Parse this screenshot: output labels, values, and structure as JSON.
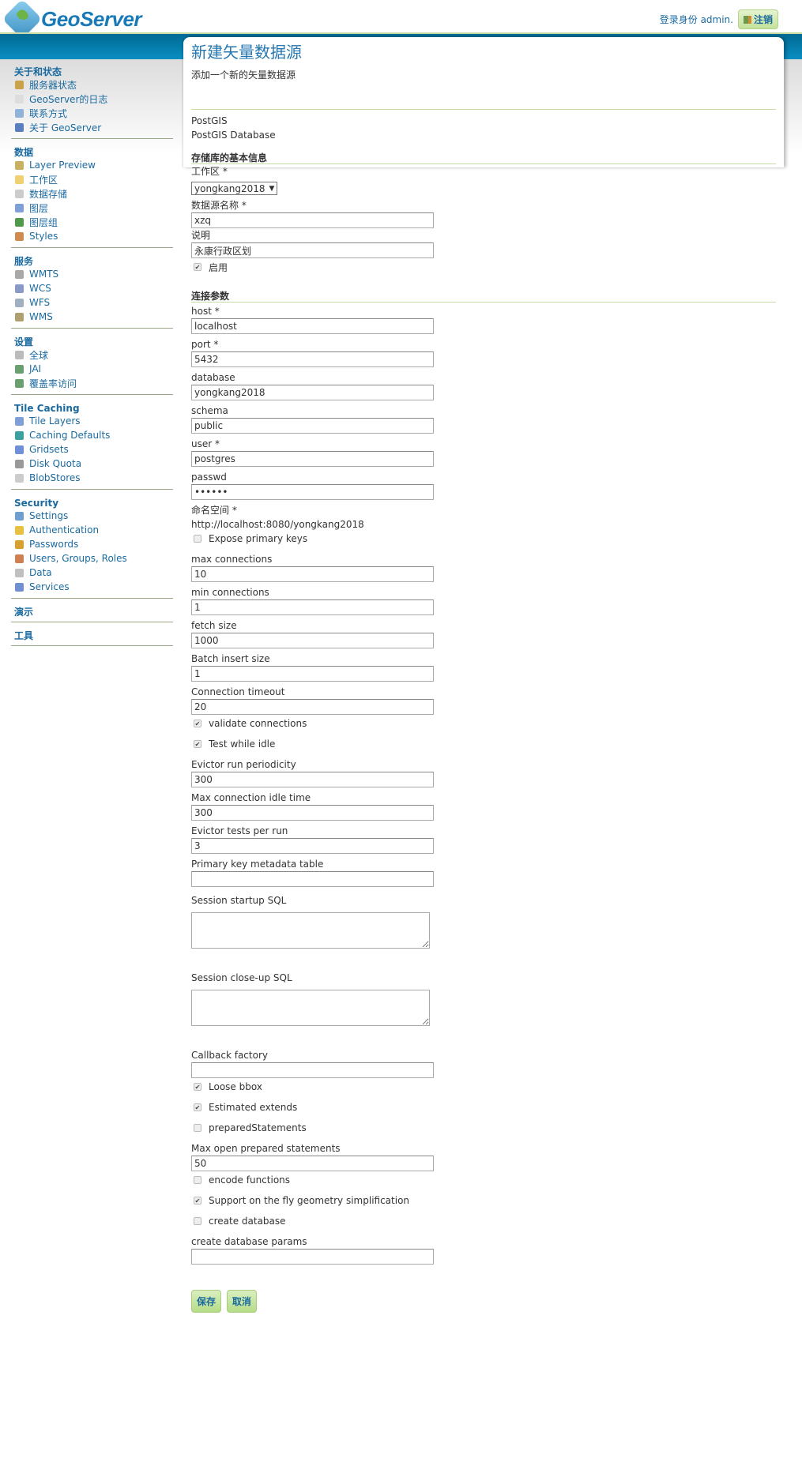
{
  "header": {
    "app_name": "GeoServer",
    "login_text": "登录身份 admin.",
    "logout_label": "注销"
  },
  "colors": {
    "brand_blue": "#1a7ab7",
    "band_blue": "#0a8ec2",
    "accent_green": "#c9dca6",
    "link": "#1a6aa0"
  },
  "sidebar": {
    "sections": [
      {
        "title": "关于和状态",
        "items": [
          {
            "label": "服务器状态",
            "icon": "server-status-icon"
          },
          {
            "label": "GeoServer的日志",
            "icon": "log-icon"
          },
          {
            "label": "联系方式",
            "icon": "contact-icon"
          },
          {
            "label": "关于 GeoServer",
            "icon": "about-icon"
          }
        ]
      },
      {
        "title": "数据",
        "items": [
          {
            "label": "Layer Preview",
            "icon": "layer-preview-icon"
          },
          {
            "label": "工作区",
            "icon": "folder-icon"
          },
          {
            "label": "数据存储",
            "icon": "datastore-icon"
          },
          {
            "label": "图层",
            "icon": "layer-icon"
          },
          {
            "label": "图层组",
            "icon": "layer-group-icon"
          },
          {
            "label": "Styles",
            "icon": "palette-icon"
          }
        ]
      },
      {
        "title": "服务",
        "items": [
          {
            "label": "WMTS",
            "icon": "wmts-icon"
          },
          {
            "label": "WCS",
            "icon": "wcs-icon"
          },
          {
            "label": "WFS",
            "icon": "wfs-icon"
          },
          {
            "label": "WMS",
            "icon": "wms-icon"
          }
        ]
      },
      {
        "title": "设置",
        "items": [
          {
            "label": "全球",
            "icon": "global-settings-icon"
          },
          {
            "label": "JAI",
            "icon": "jai-icon"
          },
          {
            "label": "覆盖率访问",
            "icon": "coverage-access-icon"
          }
        ]
      },
      {
        "title": "Tile Caching",
        "items": [
          {
            "label": "Tile Layers",
            "icon": "tile-layers-icon"
          },
          {
            "label": "Caching Defaults",
            "icon": "globe-icon"
          },
          {
            "label": "Gridsets",
            "icon": "grid-icon"
          },
          {
            "label": "Disk Quota",
            "icon": "disk-icon"
          },
          {
            "label": "BlobStores",
            "icon": "blobstore-icon"
          }
        ]
      },
      {
        "title": "Security",
        "items": [
          {
            "label": "Settings",
            "icon": "wrench-icon"
          },
          {
            "label": "Authentication",
            "icon": "shield-icon"
          },
          {
            "label": "Passwords",
            "icon": "lock-icon"
          },
          {
            "label": "Users, Groups, Roles",
            "icon": "users-icon"
          },
          {
            "label": "Data",
            "icon": "data-key-icon"
          },
          {
            "label": "Services",
            "icon": "services-key-icon"
          }
        ]
      },
      {
        "title": "演示",
        "items": []
      },
      {
        "title": "工具",
        "items": []
      }
    ]
  },
  "main": {
    "title": "新建矢量数据源",
    "description": "添加一个新的矢量数据源",
    "store_type": "PostGIS",
    "store_type_desc": "PostGIS Database",
    "basic_section": "存储库的基本信息",
    "workspace_label": "工作区 *",
    "workspace_value": "yongkang2018",
    "name_label": "数据源名称 *",
    "name_value": "xzq",
    "desc_label": "说明",
    "desc_value": "永康行政区划",
    "enabled_label": "启用",
    "enabled_checked": true,
    "conn_section": "连接参数",
    "host_label": "host *",
    "host_value": "localhost",
    "port_label": "port *",
    "port_value": "5432",
    "database_label": "database",
    "database_value": "yongkang2018",
    "schema_label": "schema",
    "schema_value": "public",
    "user_label": "user *",
    "user_value": "postgres",
    "passwd_label": "passwd",
    "passwd_value": "••••••",
    "namespace_label": "命名空间 *",
    "namespace_value": "http://localhost:8080/yongkang2018",
    "expose_pk_label": "Expose primary keys",
    "expose_pk_checked": false,
    "max_conn_label": "max connections",
    "max_conn_value": "10",
    "min_conn_label": "min connections",
    "min_conn_value": "1",
    "fetch_label": "fetch size",
    "fetch_value": "1000",
    "batch_label": "Batch insert size",
    "batch_value": "1",
    "timeout_label": "Connection timeout",
    "timeout_value": "20",
    "validate_label": "validate connections",
    "validate_checked": true,
    "test_idle_label": "Test while idle",
    "test_idle_checked": true,
    "evictor_label": "Evictor run periodicity",
    "evictor_value": "300",
    "max_idle_label": "Max connection idle time",
    "max_idle_value": "300",
    "evictor_tests_label": "Evictor tests per run",
    "evictor_tests_value": "3",
    "pk_table_label": "Primary key metadata table",
    "pk_table_value": "",
    "startup_sql_label": "Session startup SQL",
    "startup_sql_value": "",
    "closeup_sql_label": "Session close-up SQL",
    "closeup_sql_value": "",
    "callback_label": "Callback factory",
    "callback_value": "",
    "loose_bbox_label": "Loose bbox",
    "loose_bbox_checked": true,
    "est_extends_label": "Estimated extends",
    "est_extends_checked": true,
    "prepared_label": "preparedStatements",
    "prepared_checked": false,
    "max_prepared_label": "Max open prepared statements",
    "max_prepared_value": "50",
    "encode_fn_label": "encode functions",
    "encode_fn_checked": false,
    "simplify_label": "Support on the fly geometry simplification",
    "simplify_checked": true,
    "create_db_label": "create database",
    "create_db_checked": false,
    "create_db_params_label": "create database params",
    "create_db_params_value": "",
    "save_label": "保存",
    "cancel_label": "取消"
  }
}
